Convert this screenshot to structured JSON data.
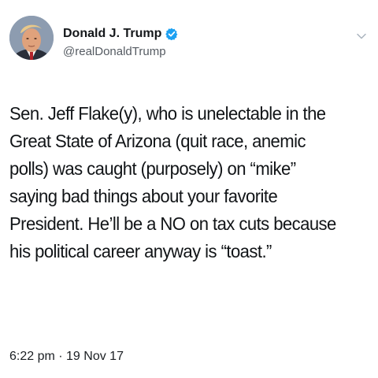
{
  "author": {
    "display_name": "Donald J. Trump",
    "handle": "@realDonaldTrump",
    "verified": true,
    "avatar_icon": "profile-photo",
    "verified_icon": "verified-badge-icon",
    "verified_color": "#1da1f2"
  },
  "menu": {
    "caret_icon": "chevron-down-icon"
  },
  "tweet": {
    "text": "Sen. Jeff Flake(y), who is unelectable in the Great State of Arizona (quit race, anemic polls) was caught (purposely) on “mike” saying bad things about your favorite President. He’ll be a NO on tax cuts because his political career anyway is “toast.”",
    "timestamp": "6:22 pm · 19 Nov 17"
  }
}
